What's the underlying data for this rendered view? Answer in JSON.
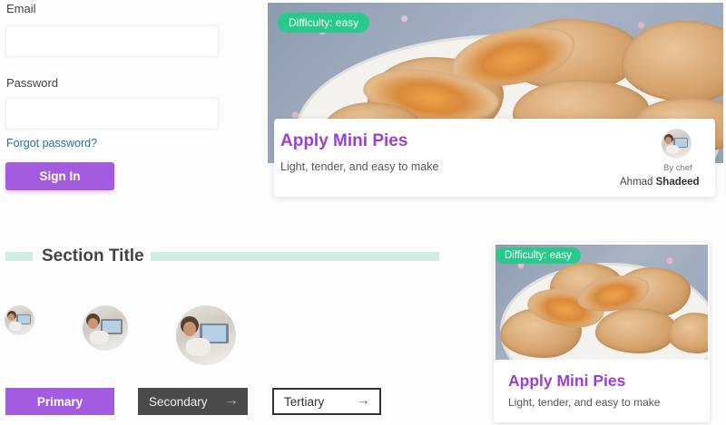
{
  "login": {
    "email_label": "Email",
    "email_value": "",
    "password_label": "Password",
    "password_value": "",
    "forgot_link": "Forgot password?",
    "submit_label": "Sign In"
  },
  "featured_card": {
    "badge": "Difficulty: easy",
    "title": "Apply Mini Pies",
    "subtitle": "Light, tender, and easy to make",
    "by_label": "By chef",
    "chef_first": "Ahmad",
    "chef_last": "Shadeed"
  },
  "section": {
    "title": "Section Title"
  },
  "buttons": {
    "primary": "Primary",
    "secondary": "Secondary",
    "tertiary": "Tertiary",
    "arrow": "→"
  },
  "small_card": {
    "badge": "Difficulty: easy",
    "title": "Apply Mini Pies",
    "subtitle": "Light, tender, and easy to make"
  },
  "colors": {
    "accent": "#a35ce0",
    "title": "#9b3fd6",
    "badge": "#28c98b",
    "section_bar": "#cdeee0",
    "link": "#2d6fa3"
  },
  "icons": {
    "arrow": "arrow-right-icon"
  }
}
